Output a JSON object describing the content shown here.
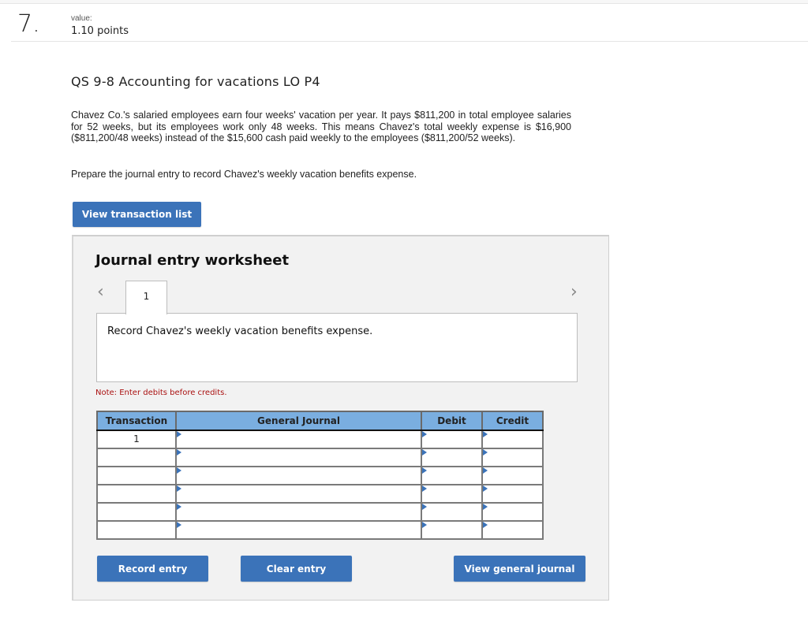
{
  "question": {
    "number": "7.",
    "value_label": "value:",
    "points": "1.10 points",
    "title": "QS 9-8 Accounting for vacations LO P4",
    "body": "Chavez Co.'s salaried employees earn four weeks' vacation per year. It pays $811,200 in total employee salaries for 52 weeks, but its employees work only 48 weeks. This means Chavez's total weekly expense is $16,900 ($811,200/48 weeks) instead of the $15,600 cash paid weekly to the employees ($811,200/52 weeks).",
    "instruction": "Prepare the journal entry to record Chavez's weekly vacation benefits expense."
  },
  "buttons": {
    "view_transaction_list": "View transaction list",
    "record_entry": "Record entry",
    "clear_entry": "Clear entry",
    "view_general_journal": "View general journal"
  },
  "worksheet": {
    "title": "Journal entry worksheet",
    "prev_icon": "‹",
    "next_icon": "›",
    "tabs": [
      {
        "label": "1"
      }
    ],
    "description": "Record Chavez's weekly vacation benefits expense.",
    "note": "Note: Enter debits before credits.",
    "columns": [
      "Transaction",
      "General Journal",
      "Debit",
      "Credit"
    ],
    "rows": [
      {
        "transaction": "1",
        "account": "",
        "debit": "",
        "credit": ""
      },
      {
        "transaction": "",
        "account": "",
        "debit": "",
        "credit": ""
      },
      {
        "transaction": "",
        "account": "",
        "debit": "",
        "credit": ""
      },
      {
        "transaction": "",
        "account": "",
        "debit": "",
        "credit": ""
      },
      {
        "transaction": "",
        "account": "",
        "debit": "",
        "credit": ""
      },
      {
        "transaction": "",
        "account": "",
        "debit": "",
        "credit": ""
      }
    ]
  },
  "colors": {
    "button_blue": "#3b73b9",
    "table_header": "#7aaee0",
    "note_red": "#aa1111",
    "panel_bg": "#f2f2f2"
  }
}
